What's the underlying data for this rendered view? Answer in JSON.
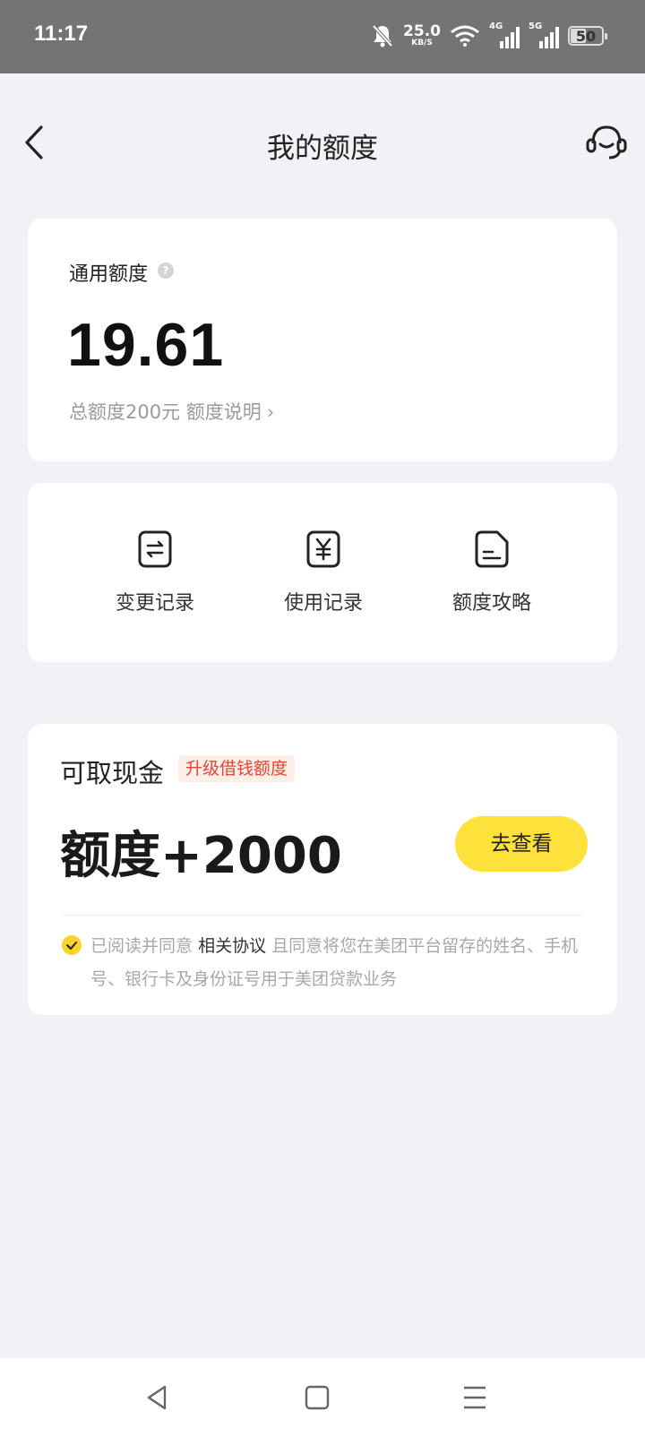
{
  "status_bar": {
    "time": "11:17",
    "net_speed_value": "25.0",
    "net_speed_unit": "KB/S",
    "signal_1_label": "4G",
    "signal_2_label": "5G",
    "battery_level": "50",
    "icons": [
      "bell-muted-icon",
      "wifi-icon",
      "signal-4g-icon",
      "signal-5g-icon",
      "battery-icon"
    ]
  },
  "header": {
    "title": "我的额度",
    "back_icon": "back-chevron-icon",
    "service_icon": "customer-service-icon"
  },
  "quota_card": {
    "label": "通用额度",
    "help_icon": "?",
    "value": "19.61",
    "total": "总额度200元",
    "explain_link": "额度说明",
    "chevron": "›"
  },
  "actions": [
    {
      "label": "变更记录",
      "icon": "change-record-icon"
    },
    {
      "label": "使用记录",
      "icon": "usage-record-icon"
    },
    {
      "label": "额度攻略",
      "icon": "quota-guide-icon"
    }
  ],
  "loan_card": {
    "title": "可取现金",
    "badge": "升级借钱额度",
    "amount": "额度+2000",
    "button": "去查看",
    "agreement_prefix": "已阅读并同意",
    "agreement_link": "相关协议",
    "agreement_suffix": "且同意将您在美团平台留存的姓名、手机号、银行卡及身份证号用于美团贷款业务",
    "agreement_checked": true
  },
  "system_nav": {
    "icons": [
      "nav-back-icon",
      "nav-home-icon",
      "nav-menu-icon"
    ]
  },
  "colors": {
    "accent_yellow": "#fee13a",
    "badge_red": "#e8452f",
    "page_bg": "#f1f2f6",
    "status_bar_bg": "#747474"
  }
}
